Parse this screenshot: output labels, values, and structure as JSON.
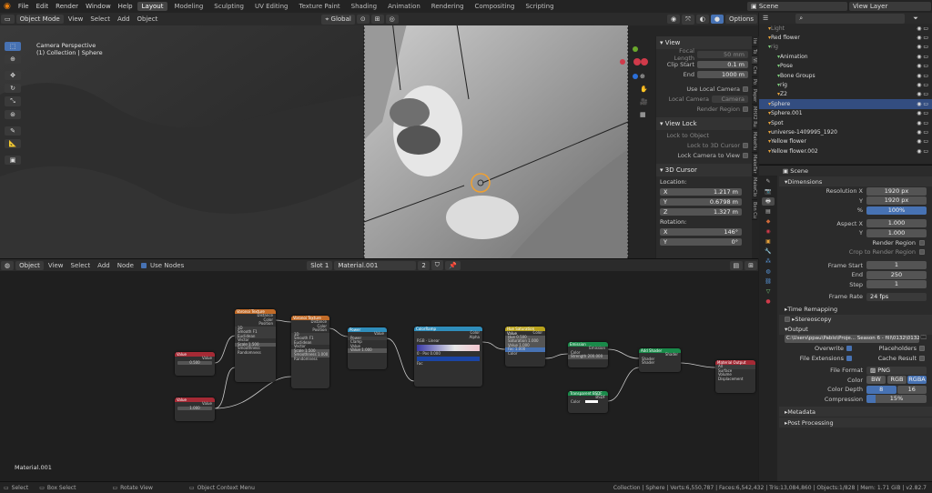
{
  "menus": [
    "File",
    "Edit",
    "Render",
    "Window",
    "Help"
  ],
  "workspaces": [
    "Layout",
    "Modeling",
    "Sculpting",
    "UV Editing",
    "Texture Paint",
    "Shading",
    "Animation",
    "Rendering",
    "Compositing",
    "Scripting"
  ],
  "scene": "Scene",
  "view_layer": "View Layer",
  "viewport": {
    "mode": "Object Mode",
    "menus": [
      "View",
      "Select",
      "Add",
      "Object"
    ],
    "orientation": "Global",
    "options": "Options",
    "info1": "Camera Perspective",
    "info2": "(1) Collection | Sphere"
  },
  "npanel": {
    "view_title": "View",
    "focal_label": "Focal Length",
    "focal": "50 mm",
    "clip_start_label": "Clip Start",
    "clip_start": "0.1 m",
    "end_label": "End",
    "end": "1000 m",
    "local_cam": "Use Local Camera",
    "local_cam_obj_label": "Local Camera",
    "local_cam_obj": "Camera",
    "render_region": "Render Region",
    "view_lock": "View Lock",
    "lock_obj": "Lock to Object",
    "lock_cursor": "Lock to 3D Cursor",
    "lock_cam": "Lock Camera to View",
    "cursor_title": "3D Cursor",
    "location": "Location:",
    "x": "X",
    "y": "Y",
    "z": "Z",
    "lx": "1.217 m",
    "ly": "0.6798 m",
    "lz": "1.327 m",
    "rotation": "Rotation:",
    "rx": "146°",
    "ry": "0°"
  },
  "sidetabs": [
    "Ite",
    "To",
    "Vi",
    "Cre",
    "Po",
    "Paper",
    "MHX2 Ru",
    "MakeHu",
    "MakeTar",
    "MakeClo",
    "Bon Cu"
  ],
  "node_editor": {
    "type": "Object",
    "menus": [
      "View",
      "Select",
      "Add",
      "Node"
    ],
    "use_nodes": "Use Nodes",
    "slot": "Slot 1",
    "material": "Material.001",
    "users": "2",
    "label": "Material.001"
  },
  "nodes": {
    "value1": {
      "title": "Value",
      "val": "0.500"
    },
    "value2": {
      "title": "Value",
      "val": "1.000"
    },
    "voronoi1": {
      "title": "Voronoi Texture",
      "rows": [
        "Distance",
        "Color",
        "Position",
        "3D",
        "Smooth F1",
        "Euclidean",
        "Vector",
        "Scale 1.500",
        "Smoothness",
        "Randomness"
      ]
    },
    "voronoi2": {
      "title": "Voronoi Texture",
      "rows": [
        "Distance",
        "Color",
        "Position",
        "3D",
        "Smooth F1",
        "Euclidean",
        "Vector",
        "Scale 1.500",
        "Smoothness 1.000",
        "Randomness"
      ]
    },
    "power": {
      "title": "Power",
      "rows": [
        "Value",
        "Power",
        "Clamp",
        "Value",
        "Value 1.000"
      ]
    },
    "ramp": {
      "title": "ColorRamp",
      "rows": [
        "Color",
        "Alpha",
        "RGB",
        "Linear",
        "0",
        "Pos 0.000",
        "Fac"
      ]
    },
    "huesat": {
      "title": "Hue Saturation Value",
      "rows": [
        "Color",
        "Hue 0.500",
        "Saturation 1.000",
        "Value 1.000",
        "Fac 1.000",
        "Color"
      ]
    },
    "emission": {
      "title": "Emission",
      "rows": [
        "Emission",
        "Color",
        "Strength 200.000"
      ]
    },
    "transparent": {
      "title": "Transparent BSDF",
      "rows": [
        "BSDF",
        "Color"
      ]
    },
    "addshader": {
      "title": "Add Shader",
      "rows": [
        "Shader",
        "Shader",
        "Shader"
      ]
    },
    "output": {
      "title": "Material Output",
      "rows": [
        "All",
        "Surface",
        "Volume",
        "Displacement"
      ]
    }
  },
  "outliner": [
    {
      "name": "Light",
      "d": 1,
      "c": "#e8a33b",
      "dim": true
    },
    {
      "name": "Red flower",
      "d": 1,
      "c": "#e8a33b"
    },
    {
      "name": "rig",
      "d": 1,
      "c": "#7ecf7e",
      "dim": true
    },
    {
      "name": "Animation",
      "d": 2,
      "c": "#7ecf7e"
    },
    {
      "name": "Pose",
      "d": 2,
      "c": "#7ecf7e"
    },
    {
      "name": "Bone Groups",
      "d": 2,
      "c": "#7ecf7e"
    },
    {
      "name": "rig",
      "d": 2,
      "c": "#7ecf7e"
    },
    {
      "name": "Z2",
      "d": 2,
      "c": "#e8a33b"
    },
    {
      "name": "Sphere",
      "d": 1,
      "c": "#e8a33b",
      "sel": true
    },
    {
      "name": "Sphere.001",
      "d": 1,
      "c": "#e8a33b"
    },
    {
      "name": "Spot",
      "d": 1,
      "c": "#e8a33b"
    },
    {
      "name": "universe-1409995_1920",
      "d": 1,
      "c": "#e8a33b"
    },
    {
      "name": "Yellow flower",
      "d": 1,
      "c": "#e8a33b"
    },
    {
      "name": "Yellow flower.002",
      "d": 1,
      "c": "#e8a33b"
    }
  ],
  "props": {
    "scene": "Scene",
    "dimensions": "Dimensions",
    "resx_label": "Resolution X",
    "resx": "1920 px",
    "y_label": "Y",
    "resy": "1920 px",
    "pct_label": "%",
    "pct": "100%",
    "aspx_label": "Aspect X",
    "aspx": "1.000",
    "aspy": "1.000",
    "render_region": "Render Region",
    "crop": "Crop to Render Region",
    "fstart_label": "Frame Start",
    "fstart": "1",
    "end_label": "End",
    "fend": "250",
    "step_label": "Step",
    "step": "1",
    "rate_label": "Frame Rate",
    "rate": "24 fps",
    "time_remap": "Time Remapping",
    "stereo": "Stereoscopy",
    "output": "Output",
    "path": "C:\\Users\\ppau\\Pablo\\Proje... Season 6 - fill\\0132\\0132",
    "overwrite": "Overwrite",
    "placeholders": "Placeholders",
    "file_ext": "File Extensions",
    "cache": "Cache Result",
    "format_label": "File Format",
    "format": "PNG",
    "color_label": "Color",
    "bw": "BW",
    "rgb": "RGB",
    "rgba": "RGBA",
    "depth_label": "Color Depth",
    "d8": "8",
    "d16": "16",
    "comp_label": "Compression",
    "comp": "15%",
    "metadata": "Metadata",
    "post": "Post Processing"
  },
  "status": {
    "select": "Select",
    "box": "Box Select",
    "rotate": "Rotate View",
    "ctx": "Object Context Menu",
    "stats": "Collection | Sphere | Verts:6,550,787 | Faces:6,542,432 | Tris:13,084,860 | Objects:1/828 | Mem: 1.71 GiB | v2.82.7"
  }
}
